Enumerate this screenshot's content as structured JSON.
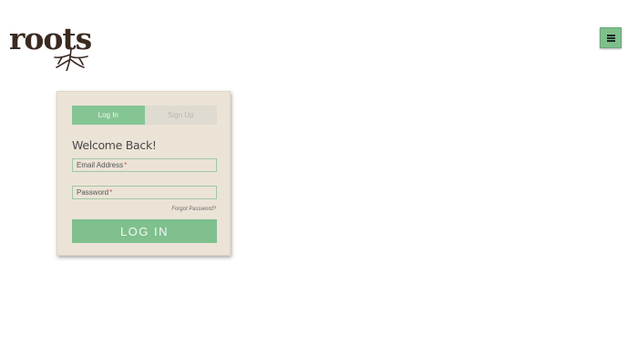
{
  "brand": {
    "logo_text": "roots"
  },
  "header": {
    "menu_icon": "hamburger-icon"
  },
  "auth": {
    "tabs": [
      {
        "label": "Log In",
        "active": true
      },
      {
        "label": "Sign Up",
        "active": false
      }
    ],
    "heading": "Welcome Back!",
    "email": {
      "label": "Email Address",
      "required_marker": "*"
    },
    "password": {
      "label": "Password",
      "required_marker": "*"
    },
    "forgot_link": "Forgot Password?",
    "submit_label": "LOG IN"
  },
  "colors": {
    "accent": "#7fc08e",
    "card_bg": "#ebe3d6",
    "logo": "#3b2a21",
    "required": "#d9534f"
  }
}
